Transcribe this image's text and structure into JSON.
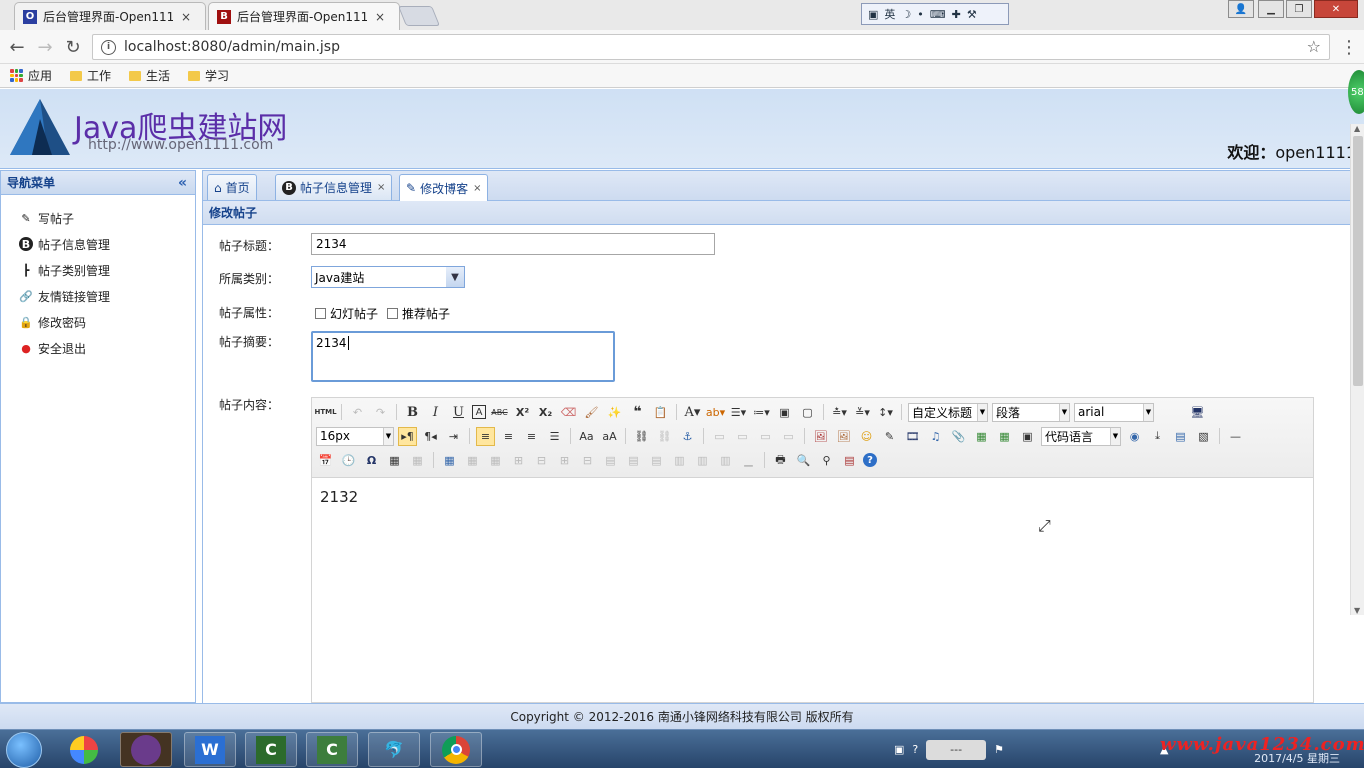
{
  "browser": {
    "tabs": [
      {
        "title": "后台管理界面-Open111",
        "favicon": "O",
        "color": "#2a3ea0"
      },
      {
        "title": "后台管理界面-Open111",
        "favicon": "B",
        "color": "#a01010"
      }
    ],
    "tab_close": "×",
    "url": "localhost:8080/admin/main.jsp",
    "ime_label": "英",
    "bookmarks": [
      {
        "label": "应用",
        "icon": "apps-icon"
      },
      {
        "label": "工作",
        "icon": "folder-icon"
      },
      {
        "label": "生活",
        "icon": "folder-icon"
      },
      {
        "label": "学习",
        "icon": "folder-icon"
      }
    ]
  },
  "header": {
    "logo_text": "Java爬虫建站网",
    "logo_url": "http://www.open1111.com",
    "welcome_label": "欢迎：",
    "welcome_user": "open1111"
  },
  "nav": {
    "title": "导航菜单",
    "collapse": "«",
    "items": [
      {
        "label": "写帖子",
        "icon": "edit-icon",
        "glyph": "✎"
      },
      {
        "label": "帖子信息管理",
        "icon": "blog-icon",
        "glyph": "B"
      },
      {
        "label": "帖子类别管理",
        "icon": "tree-icon",
        "glyph": "┣"
      },
      {
        "label": "友情链接管理",
        "icon": "link-icon",
        "glyph": "🔗"
      },
      {
        "label": "修改密码",
        "icon": "lock-icon",
        "glyph": "🔒"
      },
      {
        "label": "安全退出",
        "icon": "exit-icon",
        "glyph": "●"
      }
    ]
  },
  "tabs": [
    {
      "label": "首页",
      "icon": "home-icon",
      "glyph": "⌂",
      "closable": false
    },
    {
      "label": "帖子信息管理",
      "icon": "blog-icon",
      "glyph": "B",
      "closable": true
    },
    {
      "label": "修改博客",
      "icon": "edit-icon",
      "glyph": "✎",
      "closable": true
    }
  ],
  "tab_close": "×",
  "panel_title": "修改帖子",
  "form": {
    "title_label": "帖子标题：",
    "title_value": "2134",
    "category_label": "所属类别：",
    "category_value": "Java建站",
    "attr_label": "帖子属性：",
    "attr_options": [
      {
        "label": "幻灯帖子",
        "checked": false
      },
      {
        "label": "推荐帖子",
        "checked": false
      }
    ],
    "summary_label": "帖子摘要：",
    "summary_value": "2134",
    "content_label": "帖子内容：",
    "content_value": "2132"
  },
  "editor": {
    "font_size": "16px",
    "custom_title": "自定义标题",
    "paragraph": "段落",
    "font_family": "arial",
    "code_lang": "代码语言"
  },
  "footer": "Copyright © 2012-2016 南通小锋网络科技有限公司 版权所有",
  "taskbar": {
    "apps": [
      "W",
      "C",
      "C",
      "🐬",
      "◎"
    ],
    "watermark": "www.java1234.com",
    "date": "2017/4/5 星期三",
    "badge": "58"
  }
}
